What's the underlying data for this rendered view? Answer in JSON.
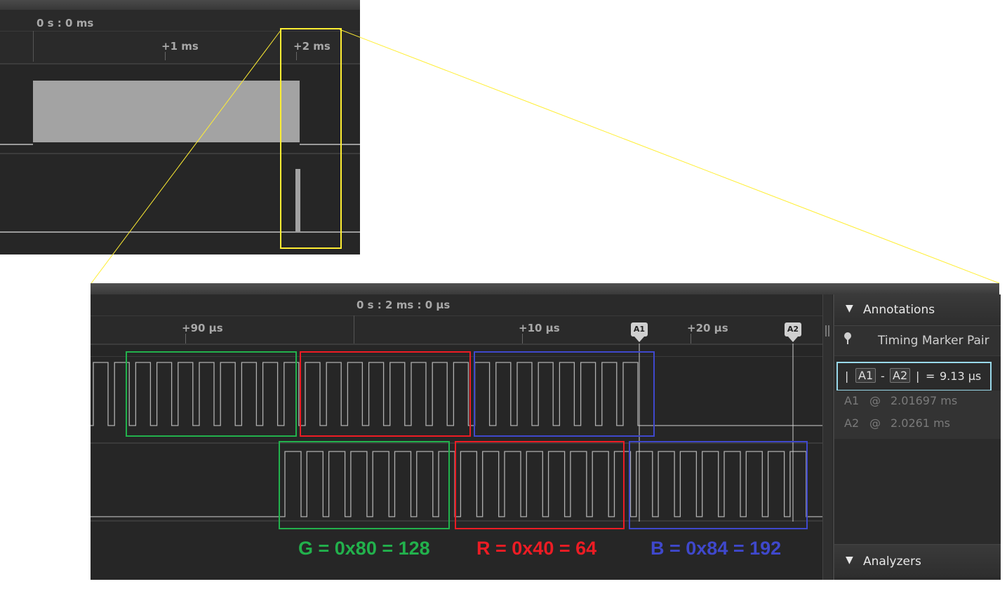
{
  "overview": {
    "time_origin": "0 s : 0 ms",
    "ticks": [
      "+1 ms",
      "+2 ms"
    ]
  },
  "detail": {
    "time_origin": "0 s : 2 ms : 0 µs",
    "ticks": [
      "+90 µs",
      "+10 µs",
      "+20 µs"
    ],
    "markers": [
      "A1",
      "A2"
    ]
  },
  "annotations": {
    "title": "Annotations",
    "pair_label": "Timing Marker Pair",
    "measure": {
      "bar": "|",
      "a": "A1",
      "dash": "-",
      "b": "A2",
      "bar2": "|",
      "eq": "=",
      "value": "9.13 µs"
    },
    "a1": {
      "name": "A1",
      "at": "@",
      "time": "2.01697 ms"
    },
    "a2": {
      "name": "A2",
      "at": "@",
      "time": "2.0261 ms"
    }
  },
  "analyzers": {
    "title": "Analyzers"
  },
  "captions": {
    "g": "G = 0x80 = 128",
    "r": "R = 0x40 = 64",
    "b": "B = 0x84 = 192"
  },
  "colors": {
    "green": "#22b14c",
    "red": "#ed1c24",
    "blue": "#3f48cc",
    "yellow": "#ffee33",
    "cyan": "#99d9ea"
  }
}
